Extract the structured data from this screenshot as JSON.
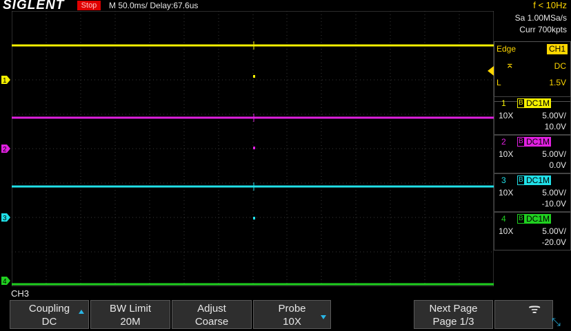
{
  "header": {
    "brand": "SIGLENT",
    "run_state": "Stop",
    "timebase": "M 50.0ms/ Delay:67.6us",
    "frequency": "f < 10Hz"
  },
  "acquisition": {
    "sample_rate": "Sa 1.00MSa/s",
    "memory_depth": "Curr 700kpts"
  },
  "trigger": {
    "type": "Edge",
    "source": "CH1",
    "slope_icon": "falling-edge-icon",
    "coupling": "DC",
    "level_label": "L",
    "level": "1.5V"
  },
  "channels": [
    {
      "num": "1",
      "bw_flag": "B",
      "coupling": "DC1M",
      "probe": "10X",
      "scale": "5.00V/",
      "offset": "10.0V",
      "color": "#f5f000"
    },
    {
      "num": "2",
      "bw_flag": "B",
      "coupling": "DC1M",
      "probe": "10X",
      "scale": "5.00V/",
      "offset": "0.0V",
      "color": "#e020e0"
    },
    {
      "num": "3",
      "bw_flag": "B",
      "coupling": "DC1M",
      "probe": "10X",
      "scale": "5.00V/",
      "offset": "-10.0V",
      "color": "#20e0e8"
    },
    {
      "num": "4",
      "bw_flag": "B",
      "coupling": "DC1M",
      "probe": "10X",
      "scale": "5.00V/",
      "offset": "-20.0V",
      "color": "#20d020"
    }
  ],
  "menu": {
    "channel": "CH3",
    "keys": [
      {
        "top": "Coupling",
        "bottom": "DC"
      },
      {
        "top": "BW Limit",
        "bottom": "20M"
      },
      {
        "top": "Adjust",
        "bottom": "Coarse"
      },
      {
        "top": "Probe",
        "bottom": "10X"
      },
      {
        "top": "Next Page",
        "bottom": "Page 1/3"
      }
    ]
  },
  "colors": {
    "trigger_marker": "#29b6e6",
    "trigger_text": "#ffd700",
    "stop_bg": "#e00000"
  }
}
